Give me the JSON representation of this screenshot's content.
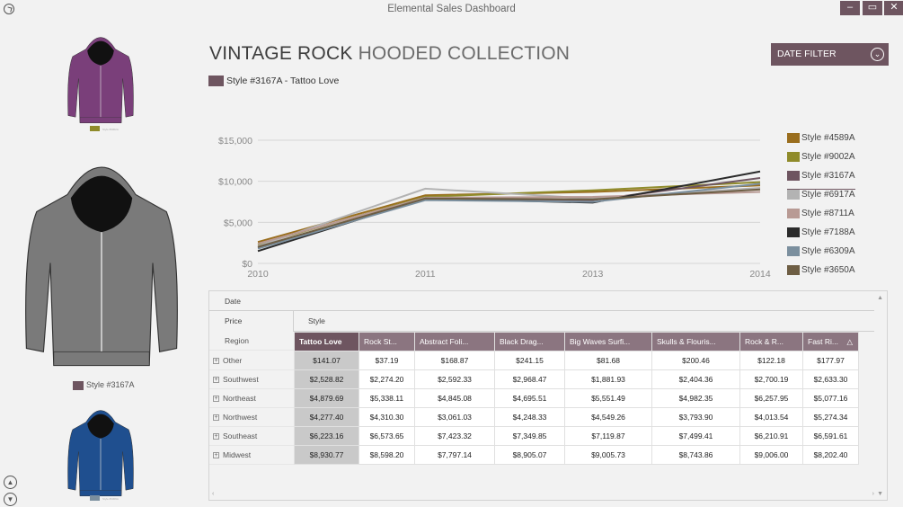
{
  "window": {
    "title": "Elemental Sales Dashboard",
    "minimize": "–",
    "maximize": "▭",
    "close": "✕"
  },
  "products": [
    {
      "caption": "Style #9002A",
      "color": "#7a3f7a",
      "swatch": "#8f8b2a"
    },
    {
      "caption": "Style #3167A",
      "color": "#7a7a7a",
      "swatch": "#6e5560"
    },
    {
      "caption": "Style #6309A",
      "color": "#1f4f8f",
      "swatch": "#7b8f9e"
    }
  ],
  "nav": {
    "up": "▲",
    "down": "▼"
  },
  "heading": {
    "strong": "VINTAGE ROCK",
    "light": " HOODED COLLECTION"
  },
  "selected_style": {
    "label": "Style #3167A - Tattoo Love",
    "color": "#6e5560"
  },
  "date_filter": {
    "label": "DATE FILTER",
    "icon": "chevron-down-icon"
  },
  "chart_data": {
    "type": "line",
    "x": [
      "2010",
      "2011",
      "2013",
      "2014"
    ],
    "ylim": [
      0,
      15000
    ],
    "yticks": [
      "$0",
      "$5,000",
      "$10,000",
      "$15,000"
    ],
    "ytick_values": [
      0,
      5000,
      10000,
      15000
    ],
    "grid": true,
    "legend_position": "right",
    "series": [
      {
        "name": "Style #4589A",
        "color": "#9a6e1e",
        "values": [
          2600,
          8300,
          8700,
          9500
        ]
      },
      {
        "name": "Style #9002A",
        "color": "#8f8b2a",
        "values": [
          2300,
          8100,
          8900,
          9900
        ]
      },
      {
        "name": "Style #3167A",
        "color": "#6e5560",
        "values": [
          1900,
          7800,
          7700,
          10400
        ]
      },
      {
        "name": "Style #6917A",
        "color": "#b3b3b3",
        "values": [
          2100,
          9100,
          7900,
          9200
        ]
      },
      {
        "name": "Style #8711A",
        "color": "#b89a94",
        "values": [
          2400,
          8000,
          8100,
          8700
        ]
      },
      {
        "name": "Style #7188A",
        "color": "#2b2b2b",
        "values": [
          1500,
          7900,
          7400,
          11200
        ]
      },
      {
        "name": "Style #6309A",
        "color": "#7b8f9e",
        "values": [
          1800,
          7700,
          7500,
          9700
        ]
      },
      {
        "name": "Style #3650A",
        "color": "#6e5e44",
        "values": [
          2000,
          7900,
          7800,
          9000
        ]
      }
    ]
  },
  "grid": {
    "fields": {
      "date": "Date",
      "price": "Price",
      "style": "Style",
      "region": "Region"
    },
    "columns": [
      "Tattoo Love",
      "Rock St...",
      "Abstract Foli...",
      "Black Drag...",
      "Big Waves Surfi...",
      "Skulls & Flouris...",
      "Rock & R...",
      "Fast Ri..."
    ],
    "sort_icon": "△",
    "rows": [
      {
        "region": "Other",
        "values": [
          "$141.07",
          "$37.19",
          "$168.87",
          "$241.15",
          "$81.68",
          "$200.46",
          "$122.18",
          "$177.97"
        ]
      },
      {
        "region": "Southwest",
        "values": [
          "$2,528.82",
          "$2,274.20",
          "$2,592.33",
          "$2,968.47",
          "$1,881.93",
          "$2,404.36",
          "$2,700.19",
          "$2,633.30"
        ]
      },
      {
        "region": "Northeast",
        "values": [
          "$4,879.69",
          "$5,338.11",
          "$4,845.08",
          "$4,695.51",
          "$5,551.49",
          "$4,982.35",
          "$6,257.95",
          "$5,077.16"
        ]
      },
      {
        "region": "Northwest",
        "values": [
          "$4,277.40",
          "$4,310.30",
          "$3,061.03",
          "$4,248.33",
          "$4,549.26",
          "$3,793.90",
          "$4,013.54",
          "$5,274.34"
        ]
      },
      {
        "region": "Southeast",
        "values": [
          "$6,223.16",
          "$6,573.65",
          "$7,423.32",
          "$7,349.85",
          "$7,119.87",
          "$7,499.41",
          "$6,210.91",
          "$6,591.61"
        ]
      },
      {
        "region": "Midwest",
        "values": [
          "$8,930.77",
          "$8,598.20",
          "$7,797.14",
          "$8,905.07",
          "$9,005.73",
          "$8,743.86",
          "$9,006.00",
          "$8,202.40"
        ]
      }
    ]
  }
}
